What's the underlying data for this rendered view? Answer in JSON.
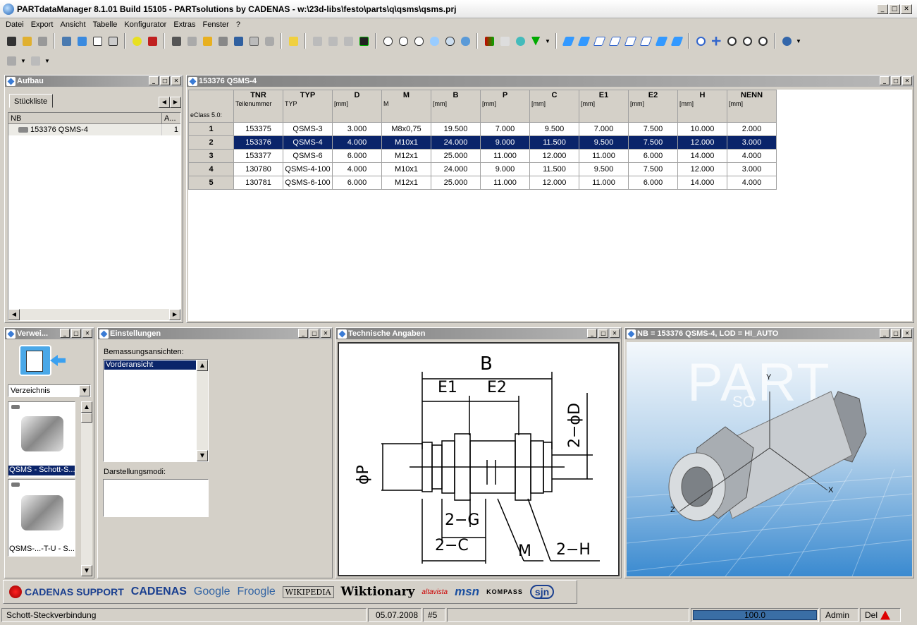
{
  "app": {
    "title": "PARTdataManager 8.1.01 Build 15105 - PARTsolutions by CADENAS - w:\\23d-libs\\festo\\parts\\q\\qsms\\qsms.prj"
  },
  "menu": [
    "Datei",
    "Export",
    "Ansicht",
    "Tabelle",
    "Konfigurator",
    "Extras",
    "Fenster",
    "?"
  ],
  "aufbau": {
    "title": "Aufbau",
    "tab": "Stückliste",
    "col_nb": "NB",
    "col_a": "A...",
    "row_name": "153376 QSMS-4",
    "row_count": "1"
  },
  "table_panel": {
    "title": "153376 QSMS-4",
    "eclass": "eClass 5.0:",
    "columns": [
      {
        "name": "TNR",
        "sub": "Teilenummer"
      },
      {
        "name": "TYP",
        "sub": "TYP"
      },
      {
        "name": "D",
        "sub": "[mm]"
      },
      {
        "name": "M",
        "sub": "M"
      },
      {
        "name": "B",
        "sub": "[mm]"
      },
      {
        "name": "P",
        "sub": "[mm]"
      },
      {
        "name": "C",
        "sub": "[mm]"
      },
      {
        "name": "E1",
        "sub": "[mm]"
      },
      {
        "name": "E2",
        "sub": "[mm]"
      },
      {
        "name": "H",
        "sub": "[mm]"
      },
      {
        "name": "NENN",
        "sub": "[mm]"
      }
    ],
    "rows": [
      {
        "n": "1",
        "cells": [
          "153375",
          "QSMS-3",
          "3.000",
          "M8x0,75",
          "19.500",
          "7.000",
          "9.500",
          "7.000",
          "7.500",
          "10.000",
          "2.000"
        ]
      },
      {
        "n": "2",
        "cells": [
          "153376",
          "QSMS-4",
          "4.000",
          "M10x1",
          "24.000",
          "9.000",
          "11.500",
          "9.500",
          "7.500",
          "12.000",
          "3.000"
        ]
      },
      {
        "n": "3",
        "cells": [
          "153377",
          "QSMS-6",
          "6.000",
          "M12x1",
          "25.000",
          "11.000",
          "12.000",
          "11.000",
          "6.000",
          "14.000",
          "4.000"
        ]
      },
      {
        "n": "4",
        "cells": [
          "130780",
          "QSMS-4-100",
          "4.000",
          "M10x1",
          "24.000",
          "9.000",
          "11.500",
          "9.500",
          "7.500",
          "12.000",
          "3.000"
        ]
      },
      {
        "n": "5",
        "cells": [
          "130781",
          "QSMS-6-100",
          "6.000",
          "M12x1",
          "25.000",
          "11.000",
          "12.000",
          "11.000",
          "6.000",
          "14.000",
          "4.000"
        ]
      }
    ],
    "selected_row": 2
  },
  "verweis": {
    "title": "Verwei...",
    "dropdown": "Verzeichnis",
    "items": [
      "QSMS - Schott-S...",
      "QSMS-...-T-U - S..."
    ]
  },
  "einstellungen": {
    "title": "Einstellungen",
    "label1": "Bemassungsansichten:",
    "list1": [
      "Vorderansicht"
    ],
    "label2": "Darstellungsmodi:"
  },
  "technische": {
    "title": "Technische Angaben",
    "labels": {
      "b": "B",
      "e1": "E1",
      "e2": "E2",
      "d": "2−ϕD",
      "p": "ϕP",
      "g": "2−G",
      "c": "2−C",
      "m": "M",
      "h": "2−H"
    }
  },
  "viewer": {
    "title": "NB = 153376 QSMS-4, LOD = HI_AUTO",
    "watermark1": "PART",
    "watermark2": "SO",
    "axes": {
      "x": "X",
      "y": "Y",
      "z": "Z"
    }
  },
  "links": [
    "CADENAS SUPPORT",
    "CADENAS",
    "Google",
    "Froogle",
    "WIKIPEDIA",
    "Wiktionary",
    "altavista",
    "msn",
    "KOMPASS",
    "sjn"
  ],
  "status": {
    "text": "Schott-Steckverbindung",
    "date": "05.07.2008",
    "num": "#5",
    "progress": "100.0",
    "progress_fraction": 1.0,
    "user": "Admin",
    "del": "Del"
  }
}
